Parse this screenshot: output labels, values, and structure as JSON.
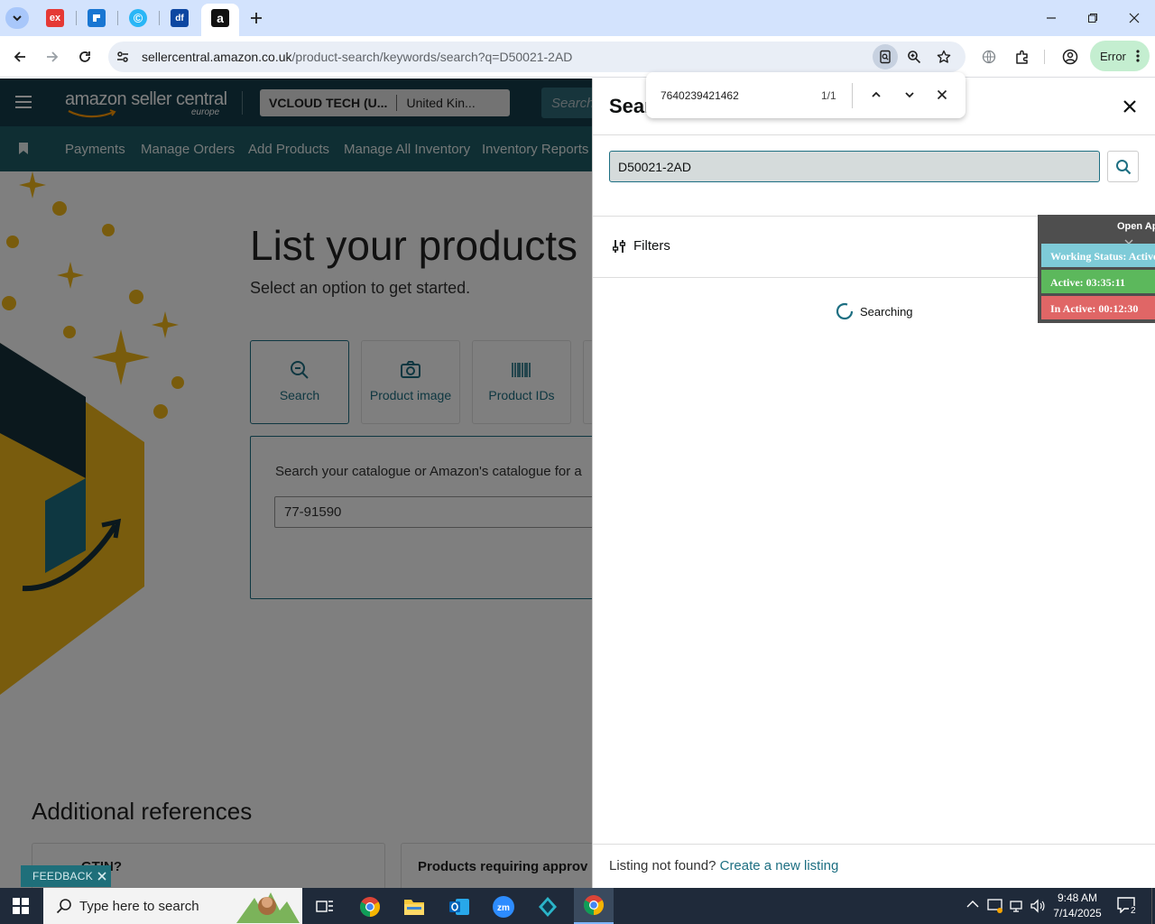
{
  "browser": {
    "tabs": [
      {
        "name": "tab-ex",
        "glyph": "ex",
        "color": "#e53935"
      },
      {
        "name": "tab-edge",
        "glyph": "",
        "color": "#1976d2"
      },
      {
        "name": "tab-c",
        "glyph": "©",
        "color": "#29b6f6"
      },
      {
        "name": "tab-df",
        "glyph": "df",
        "color": "#0d47a1"
      },
      {
        "name": "tab-amazon",
        "glyph": "a",
        "color": "#111111"
      }
    ],
    "url_host": "sellercentral.amazon.co.uk",
    "url_path": "/product-search/keywords/search?q=D50021-2AD",
    "profile_status": "Error"
  },
  "find_bar": {
    "query": "7640239421462",
    "count": "1/1"
  },
  "amazon": {
    "logo_text": "amazon seller central",
    "logo_region": "europe",
    "store_name": "VCLOUD TECH (U...",
    "store_country": "United Kin...",
    "search_placeholder": "Search",
    "nav_items": [
      "Payments",
      "Manage Orders",
      "Add Products",
      "Manage All Inventory",
      "Inventory Reports"
    ],
    "page_title": "List your products",
    "page_subtitle": "Select an option to get started.",
    "options": [
      "Search",
      "Product image",
      "Product IDs"
    ],
    "catalog_prompt": "Search your catalogue or Amazon's catalogue for a",
    "catalog_input_value": "77-91590",
    "additional_refs_title": "Additional references",
    "ref1": "GTIN?",
    "ref2": "Products requiring approv",
    "feedback": "FEEDBACK"
  },
  "panel": {
    "title": "Sear",
    "search_value": "D50021-2AD",
    "filters_label": "Filters",
    "status": "Searching",
    "not_found_text": "Listing not found?",
    "create_link": "Create a new listing"
  },
  "timer_widget": {
    "open_label": "Open Ap",
    "working_status": "Working Status: Active",
    "active": "Active: 03:35:11",
    "inactive": "In Active: 00:12:30",
    "colors": {
      "working": "#7ecbd8",
      "active": "#5cb85c",
      "inactive": "#e06666"
    }
  },
  "taskbar": {
    "search_placeholder": "Type here to search",
    "time": "9:48 AM",
    "date": "7/14/2025",
    "notification_count": "2"
  }
}
